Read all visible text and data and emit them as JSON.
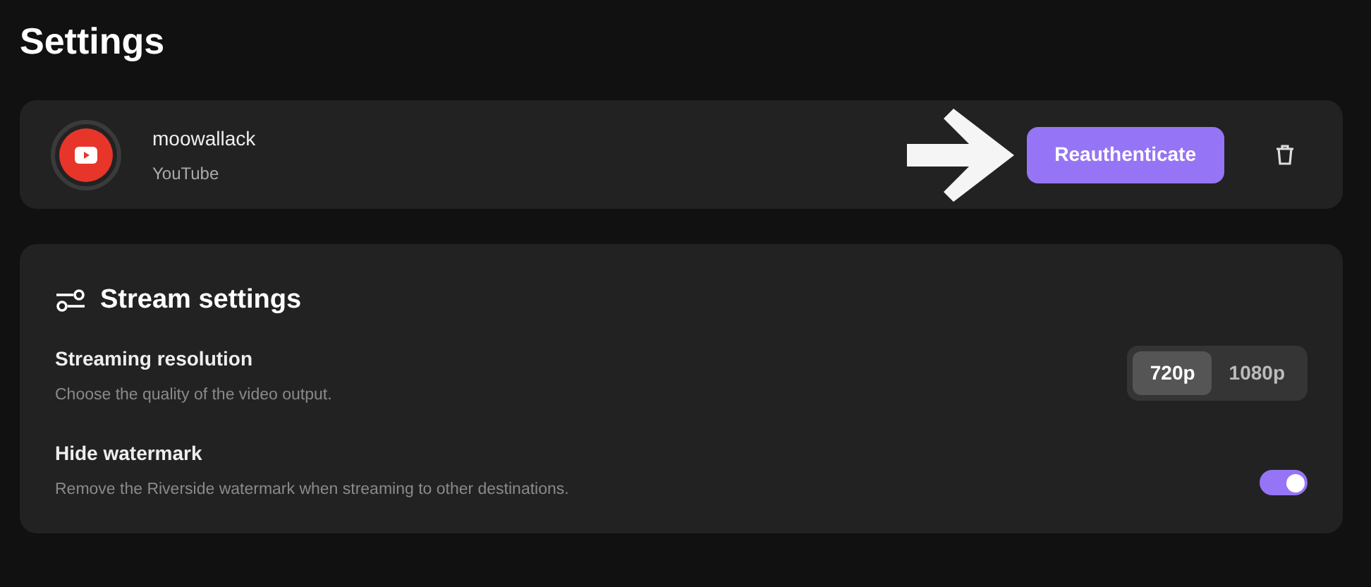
{
  "page_title": "Settings",
  "account": {
    "name": "moowallack",
    "platform": "YouTube",
    "reauth_button": "Reauthenticate"
  },
  "stream_settings": {
    "title": "Stream settings",
    "rows": [
      {
        "kind": "segmented",
        "label": "Streaming resolution",
        "description": "Choose the quality of the video output.",
        "options": [
          {
            "label": "720p",
            "selected": true
          },
          {
            "label": "1080p",
            "selected": false
          }
        ]
      },
      {
        "kind": "toggle",
        "label": "Hide watermark",
        "description": "Remove the Riverside watermark when streaming to other destinations.",
        "on": true
      }
    ]
  }
}
